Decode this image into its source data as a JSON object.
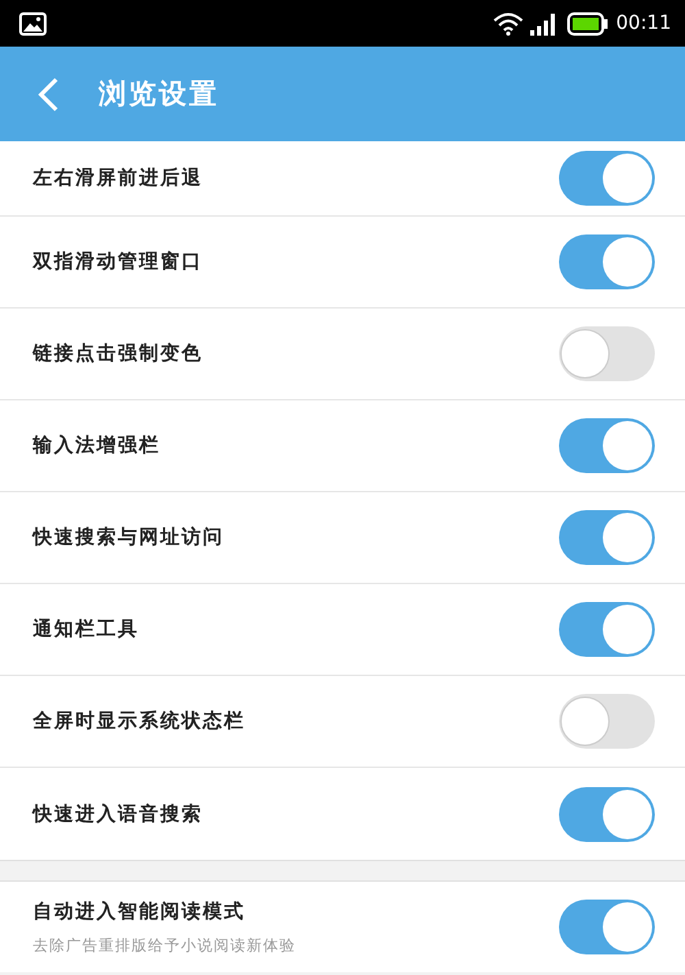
{
  "status_bar": {
    "time": "00:11"
  },
  "app_bar": {
    "title": "浏览设置"
  },
  "groups": [
    {
      "items": [
        {
          "label": "左右滑屏前进后退",
          "on": true
        },
        {
          "label": "双指滑动管理窗口",
          "on": true
        },
        {
          "label": "链接点击强制变色",
          "on": false
        },
        {
          "label": "输入法增强栏",
          "on": true
        },
        {
          "label": "快速搜索与网址访问",
          "on": true
        },
        {
          "label": "通知栏工具",
          "on": true
        },
        {
          "label": "全屏时显示系统状态栏",
          "on": false
        },
        {
          "label": "快速进入语音搜索",
          "on": true
        }
      ]
    },
    {
      "items": [
        {
          "label": "自动进入智能阅读模式",
          "subtitle": "去除广告重排版给予小说阅读新体验",
          "on": true
        }
      ]
    }
  ]
}
